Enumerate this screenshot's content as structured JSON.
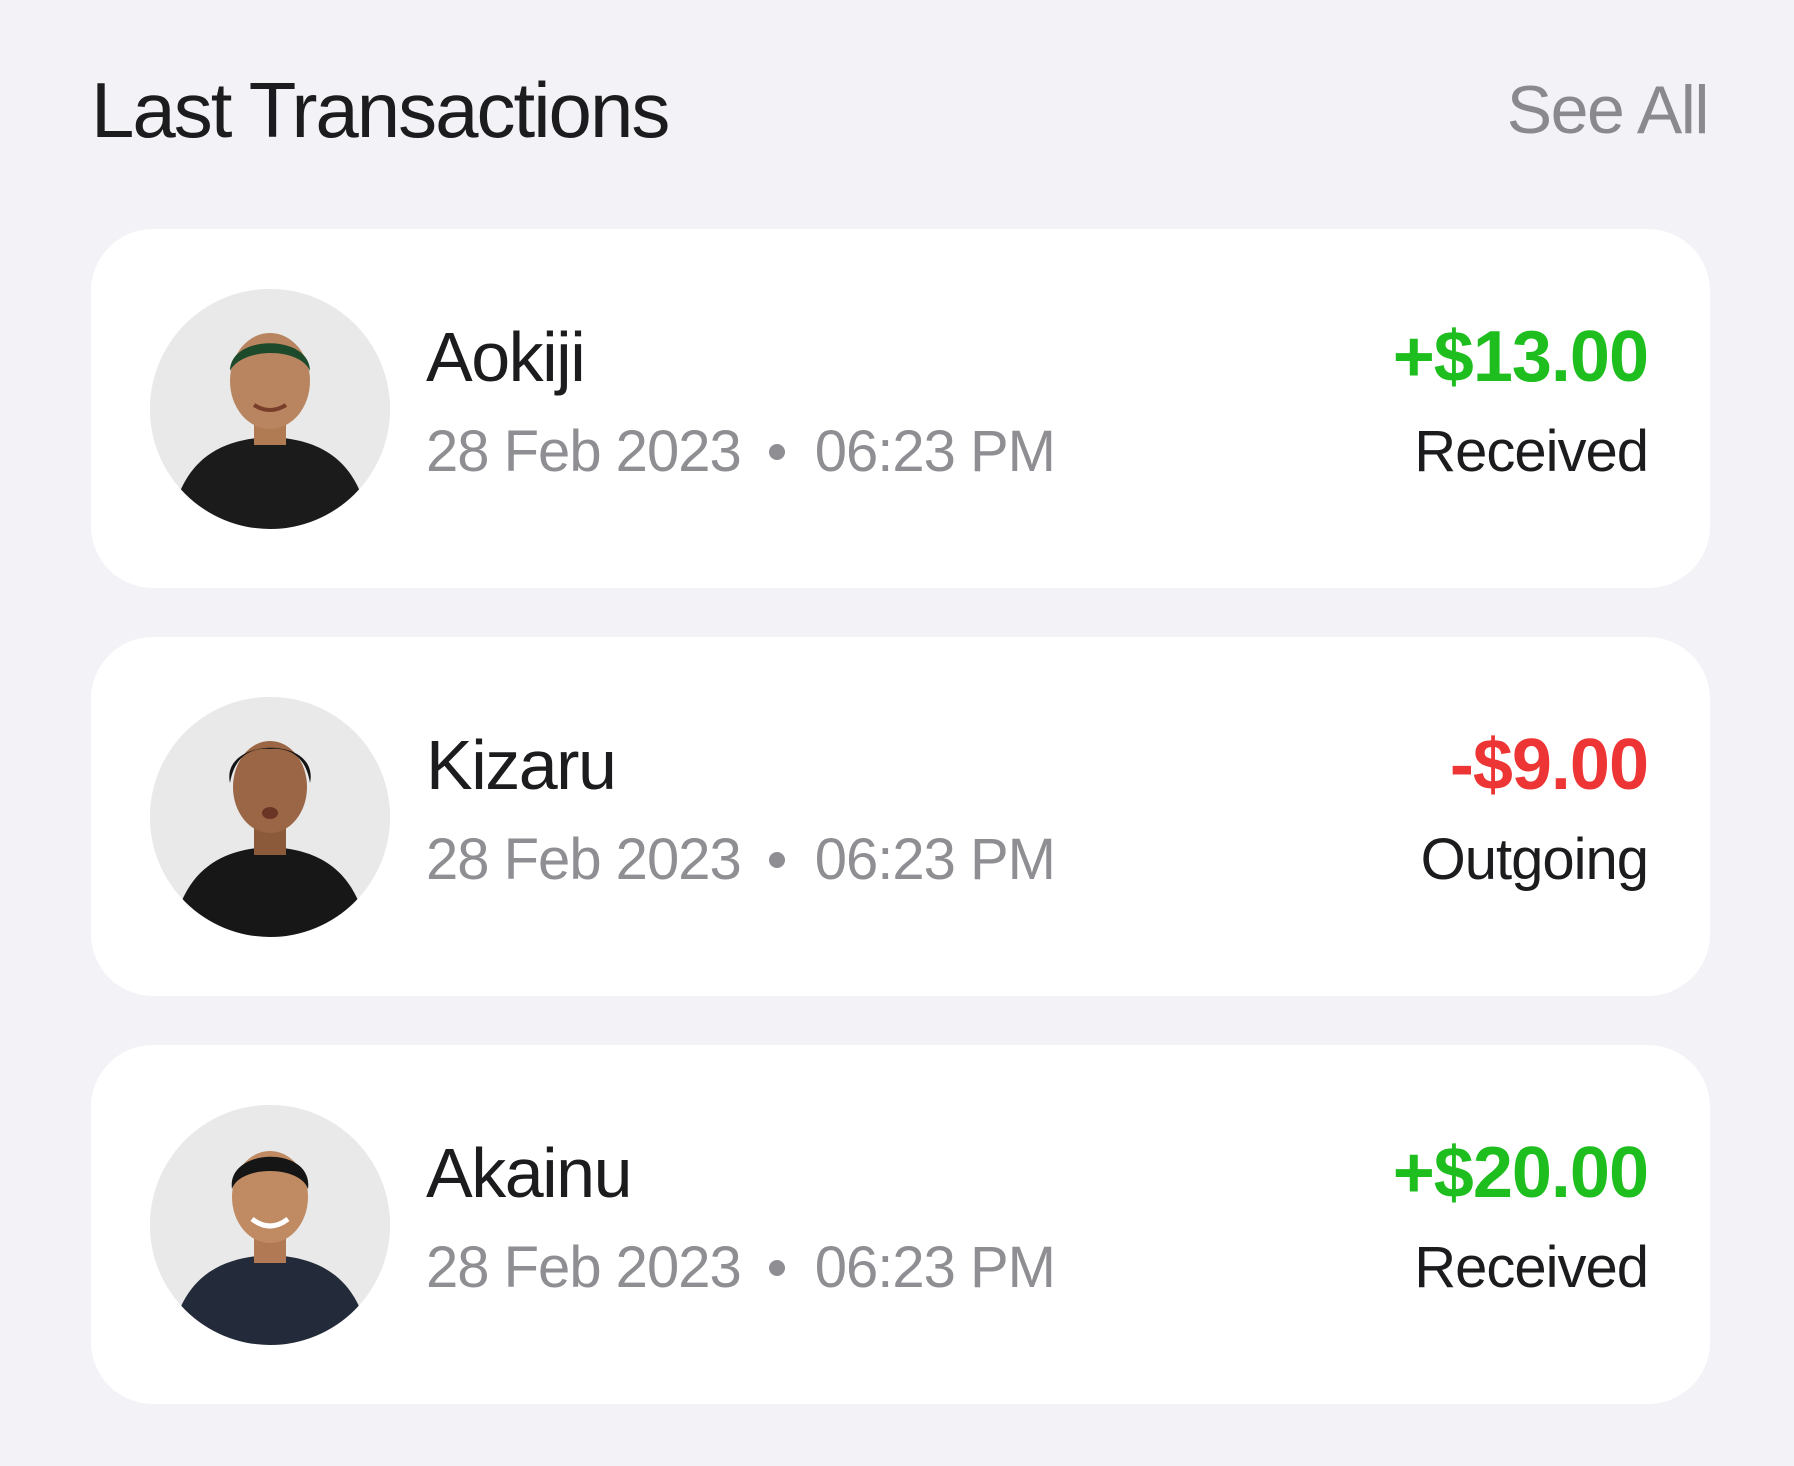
{
  "header": {
    "title": "Last Transactions",
    "see_all_label": "See All"
  },
  "colors": {
    "background": "#f3f3f7",
    "card": "#ffffff",
    "positive": "#1fbe1f",
    "negative": "#ee3535",
    "muted": "#8e8e93",
    "text": "#1c1c1e"
  },
  "transactions": [
    {
      "name": "Aokiji",
      "date": "28 Feb 2023",
      "time": "06:23 PM",
      "amount": "+$13.00",
      "status": "Received",
      "direction": "positive",
      "avatar_icon": "person-photo-icon"
    },
    {
      "name": "Kizaru",
      "date": "28 Feb 2023",
      "time": "06:23 PM",
      "amount": "-$9.00",
      "status": "Outgoing",
      "direction": "negative",
      "avatar_icon": "person-photo-icon"
    },
    {
      "name": "Akainu",
      "date": "28 Feb 2023",
      "time": "06:23 PM",
      "amount": "+$20.00",
      "status": "Received",
      "direction": "positive",
      "avatar_icon": "person-photo-icon"
    }
  ]
}
